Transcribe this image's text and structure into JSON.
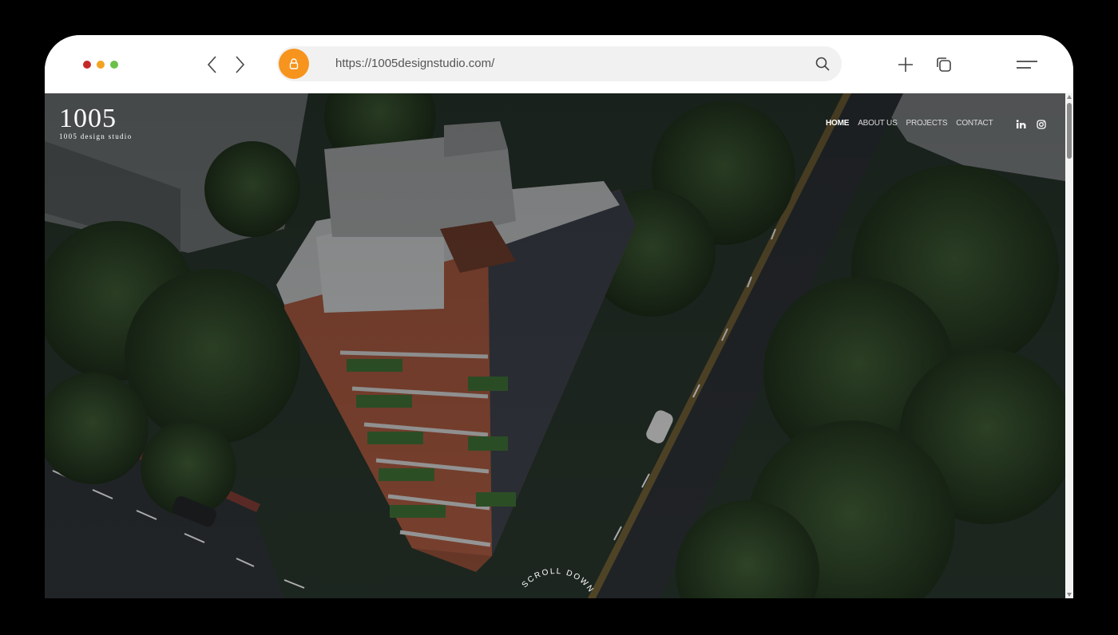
{
  "browser": {
    "url": "https://1005designstudio.com/",
    "traffic_lights": {
      "close": "#c62828",
      "minimize": "#f4a321",
      "maximize": "#6cc04a"
    },
    "lock_color": "#f7941d",
    "icons": [
      "back-icon",
      "forward-icon",
      "lock-icon",
      "search-icon",
      "new-tab-icon",
      "tabs-icon",
      "menu-icon"
    ]
  },
  "site": {
    "logo": {
      "mark": "1005",
      "subtitle": "1005 design studio"
    },
    "nav": [
      {
        "label": "HOME",
        "active": true
      },
      {
        "label": "ABOUT US",
        "active": false
      },
      {
        "label": "PROJECTS",
        "active": false
      },
      {
        "label": "CONTACT",
        "active": false
      }
    ],
    "social": [
      "linkedin-icon",
      "instagram-icon"
    ],
    "scroll_text": "SCROLL DOWN"
  }
}
